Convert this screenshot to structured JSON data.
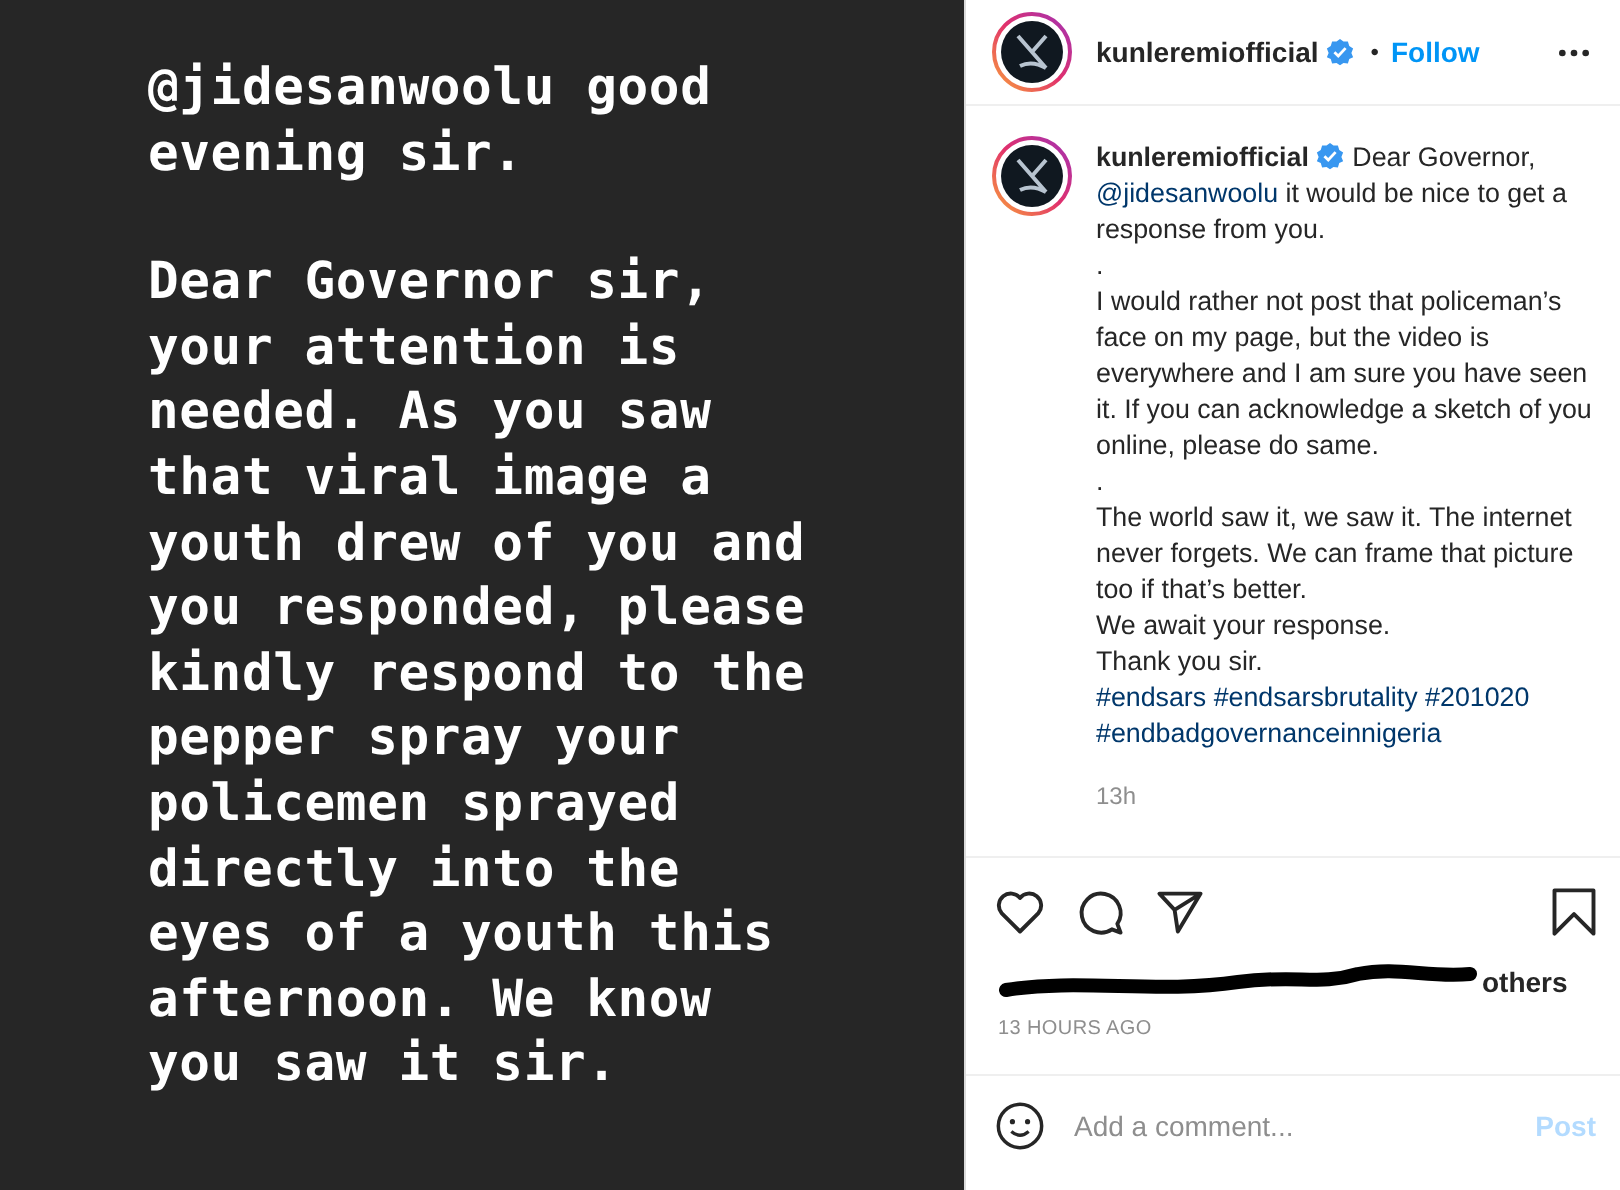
{
  "post_image": {
    "paragraphs": [
      "@jidesanwoolu good evening sir.",
      "Dear Governor sir, your attention is needed. As you saw that viral image a youth drew of you and you responded, please kindly respond to the pepper spray your policemen sprayed directly into the eyes of a youth this afternoon. We know you saw it sir."
    ]
  },
  "header": {
    "username": "kunleremiofficial",
    "verified": true,
    "separator": "•",
    "follow": "Follow"
  },
  "caption": {
    "username": "kunleremiofficial",
    "verified": true,
    "lines": [
      {
        "kind": "text",
        "text": "Dear Governor,"
      },
      {
        "kind": "mention",
        "text": "@jidesanwoolu"
      },
      {
        "kind": "text",
        "text": "it would be nice to get a response from you."
      },
      {
        "kind": "break",
        "text": "."
      },
      {
        "kind": "text",
        "text": "I would rather not post that policeman’s face on my page, but the video is everywhere and I am sure you have seen it. If you can acknowledge a sketch of you online, please do same."
      },
      {
        "kind": "break",
        "text": "."
      },
      {
        "kind": "text",
        "text": "The world saw it, we saw it. The internet never forgets. We can frame that picture too if that’s better."
      },
      {
        "kind": "break",
        "text": "We await your response."
      },
      {
        "kind": "break",
        "text": "Thank you sir."
      },
      {
        "kind": "hashtag",
        "text": "#endsars"
      },
      {
        "kind": "hashtag",
        "text": "#endsarsbrutality"
      },
      {
        "kind": "hashtag",
        "text": "#201020"
      },
      {
        "kind": "hashtag",
        "text": "#endbadgovernanceinnigeria"
      }
    ],
    "time": "13h"
  },
  "likes": {
    "text": "others"
  },
  "timestamp": "13 HOURS AGO",
  "comment": {
    "placeholder": "Add a comment...",
    "post": "Post"
  }
}
